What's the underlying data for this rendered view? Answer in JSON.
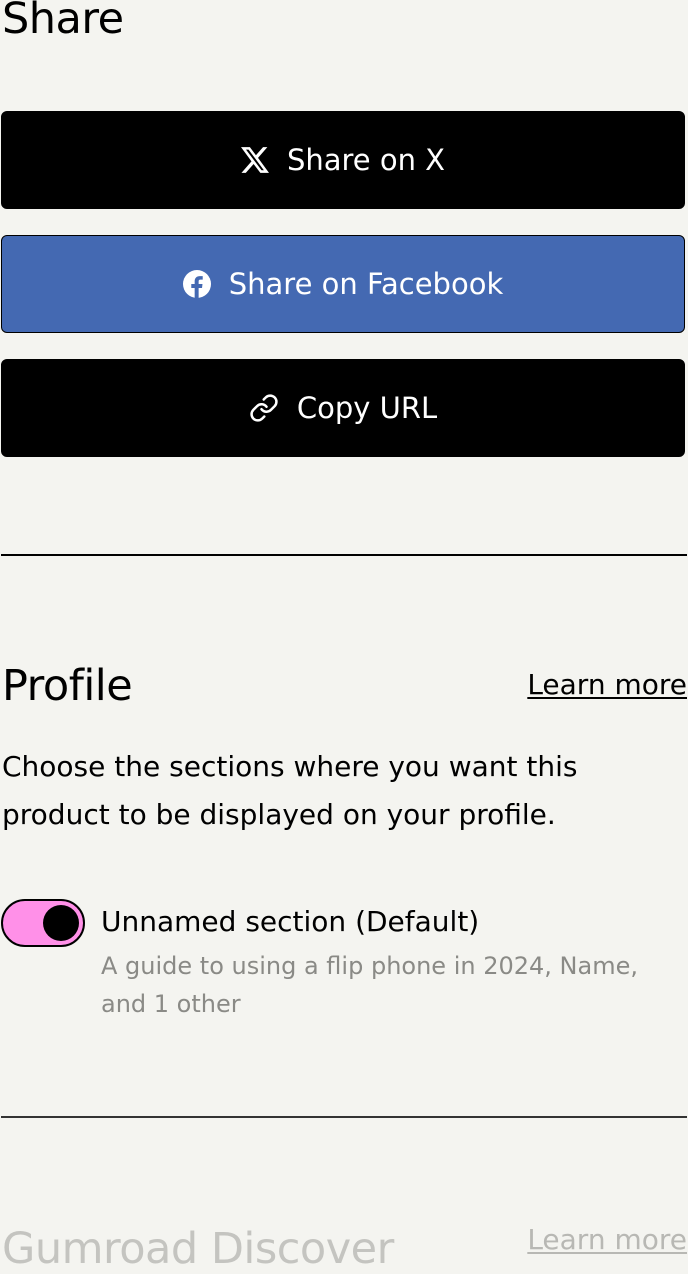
{
  "share": {
    "title": "Share",
    "buttons": [
      {
        "label": "Share on X",
        "icon": "x-logo-icon",
        "bg": "#000000"
      },
      {
        "label": "Share on Facebook",
        "icon": "facebook-logo-icon",
        "bg": "#4469b2"
      },
      {
        "label": "Copy URL",
        "icon": "link-icon",
        "bg": "#000000"
      }
    ]
  },
  "profile": {
    "title": "Profile",
    "learn_more": "Learn more",
    "description": "Choose the sections where you want this product to be displayed on your profile.",
    "sections": [
      {
        "name": "Unnamed section (Default)",
        "subtitle": "A guide to using a flip phone in 2024, Name, and 1 other",
        "enabled": true,
        "toggle_color": "#ff90e8"
      }
    ]
  },
  "discover": {
    "title": "Gumroad Discover",
    "learn_more": "Learn more"
  }
}
